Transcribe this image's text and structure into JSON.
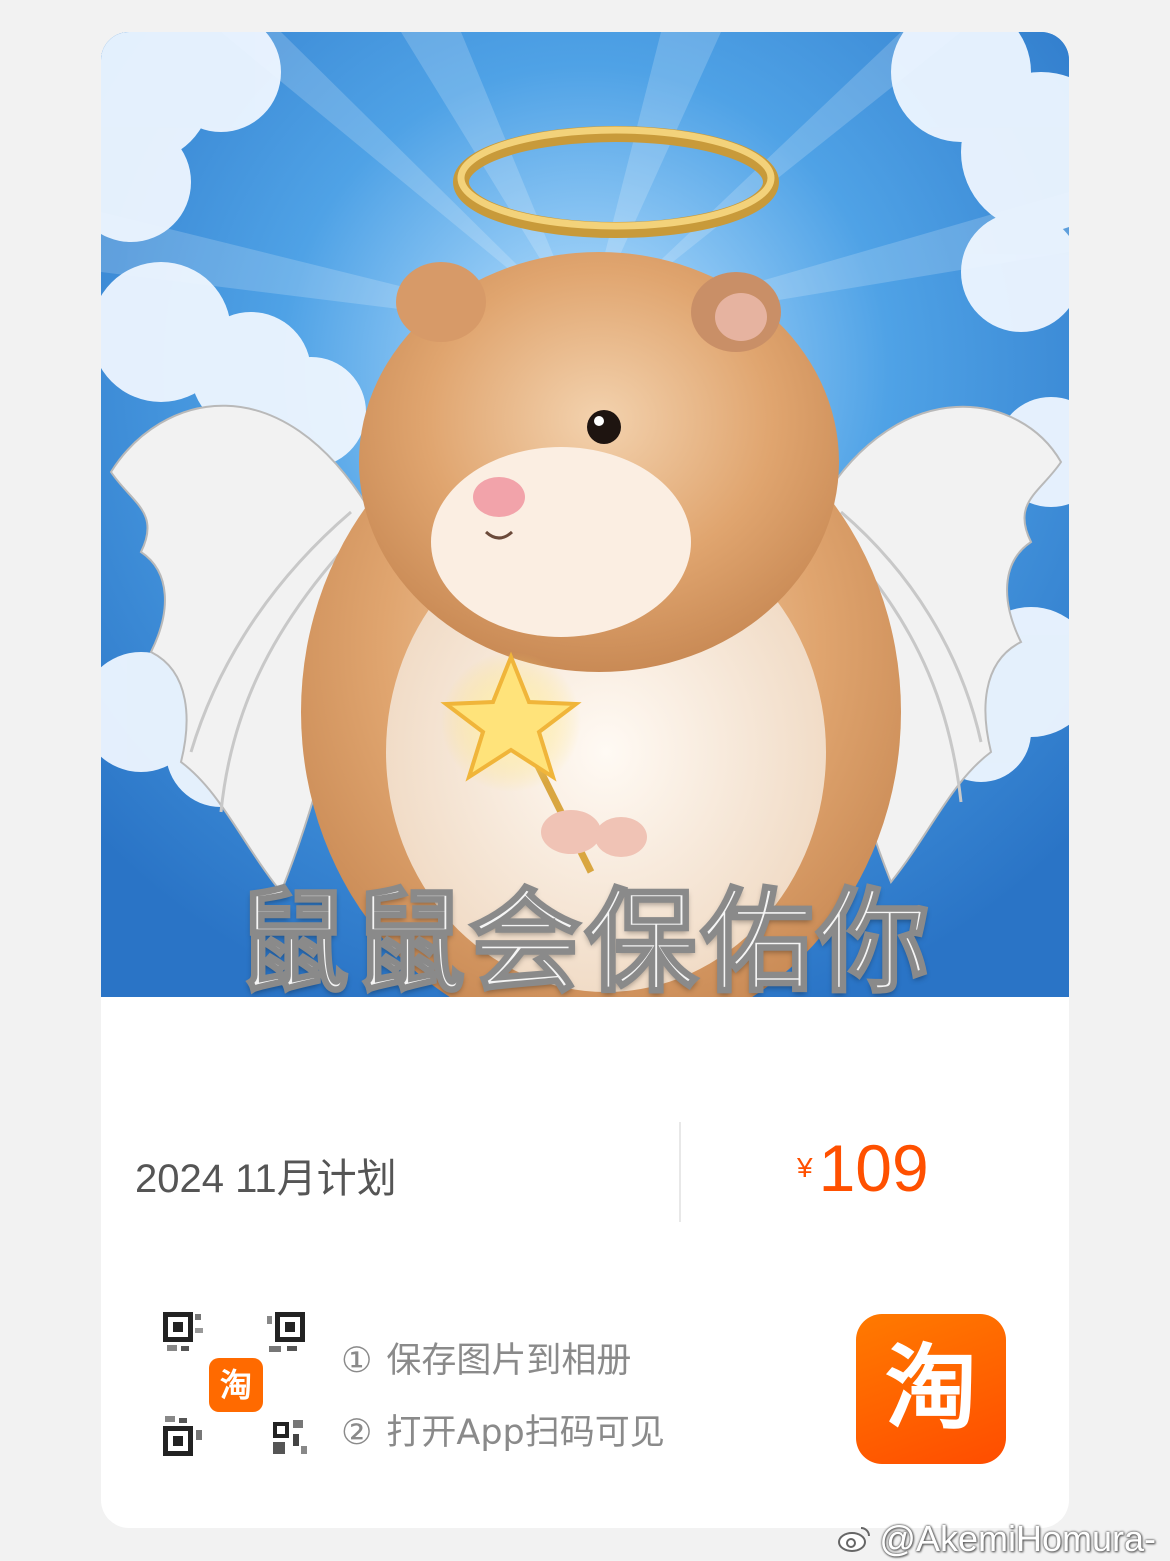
{
  "product": {
    "image_caption": "鼠鼠会保佑你",
    "plan_title": "2024 11月计划",
    "price_symbol": "¥",
    "price_amount": "109"
  },
  "share": {
    "badge_glyph": "淘",
    "step1_num": "①",
    "step1_text": "保存图片到相册",
    "step2_num": "②",
    "step2_text": "打开App扫码可见",
    "app_icon_glyph": "淘"
  },
  "watermark": {
    "icon": "weibo-icon",
    "text": "@AkemiHomura-"
  },
  "colors": {
    "accent": "#ff5000",
    "sky": "#3f8fd6"
  }
}
